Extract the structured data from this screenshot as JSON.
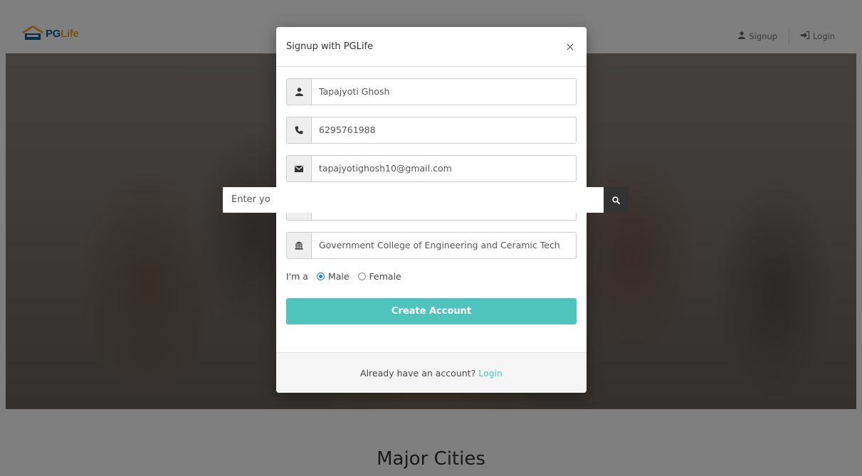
{
  "brand": {
    "pg": "PG",
    "life": "Life"
  },
  "nav": {
    "signup_label": "Signup",
    "login_label": "Login"
  },
  "hero": {
    "search_placeholder": "Enter yo"
  },
  "section": {
    "title": "Major Cities"
  },
  "modal": {
    "title": "Signup with PGLife",
    "close_symbol": "×",
    "fields": {
      "full_name": "Tapajyoti Ghosh",
      "phone": "6295761988",
      "email": "tapajyotighosh10@gmail.com",
      "password_mask": "•••••••••••",
      "college": "Government College of Engineering and Ceramic Tech"
    },
    "gender": {
      "label": "I'm a",
      "options": [
        "Male",
        "Female"
      ],
      "selected": "Male"
    },
    "submit_label": "Create Account",
    "footer_text": "Already have an account?",
    "footer_link": "Login"
  },
  "colors": {
    "accent": "#4ec4bc",
    "brand_pg": "#0f5f8a",
    "brand_life": "#f0a92a",
    "radio_checked": "#1a73e8"
  },
  "icons": {
    "name": "user-icon",
    "phone": "phone-icon",
    "email": "envelope-icon",
    "password": "lock-icon",
    "college": "university-icon",
    "search": "search-icon"
  }
}
